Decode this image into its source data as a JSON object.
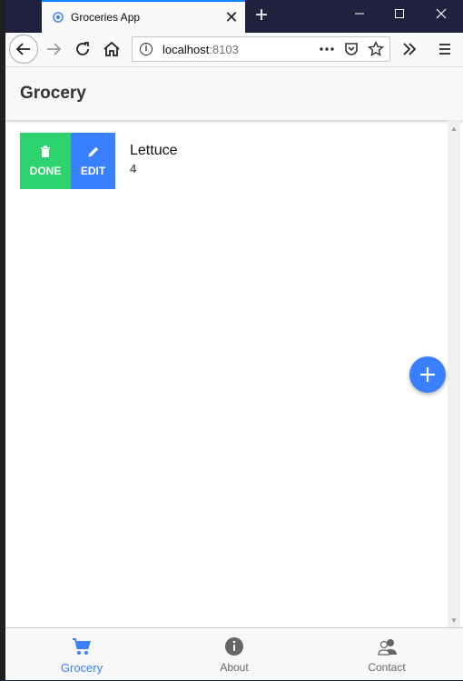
{
  "browser": {
    "tab_title": "Groceries App",
    "url_host": "localhost",
    "url_port": ":8103"
  },
  "app": {
    "header_title": "Grocery",
    "items": [
      {
        "name": "Lettuce",
        "quantity": "4",
        "done_label": "DONE",
        "edit_label": "EDIT"
      }
    ],
    "tabs": [
      {
        "label": "Grocery",
        "icon": "cart-icon",
        "active": true
      },
      {
        "label": "About",
        "icon": "info-icon",
        "active": false
      },
      {
        "label": "Contact",
        "icon": "contacts-icon",
        "active": false
      }
    ]
  },
  "colors": {
    "done": "#2dd36f",
    "edit": "#3880ff",
    "primary": "#3880ff",
    "browser_chrome": "#20213f"
  }
}
